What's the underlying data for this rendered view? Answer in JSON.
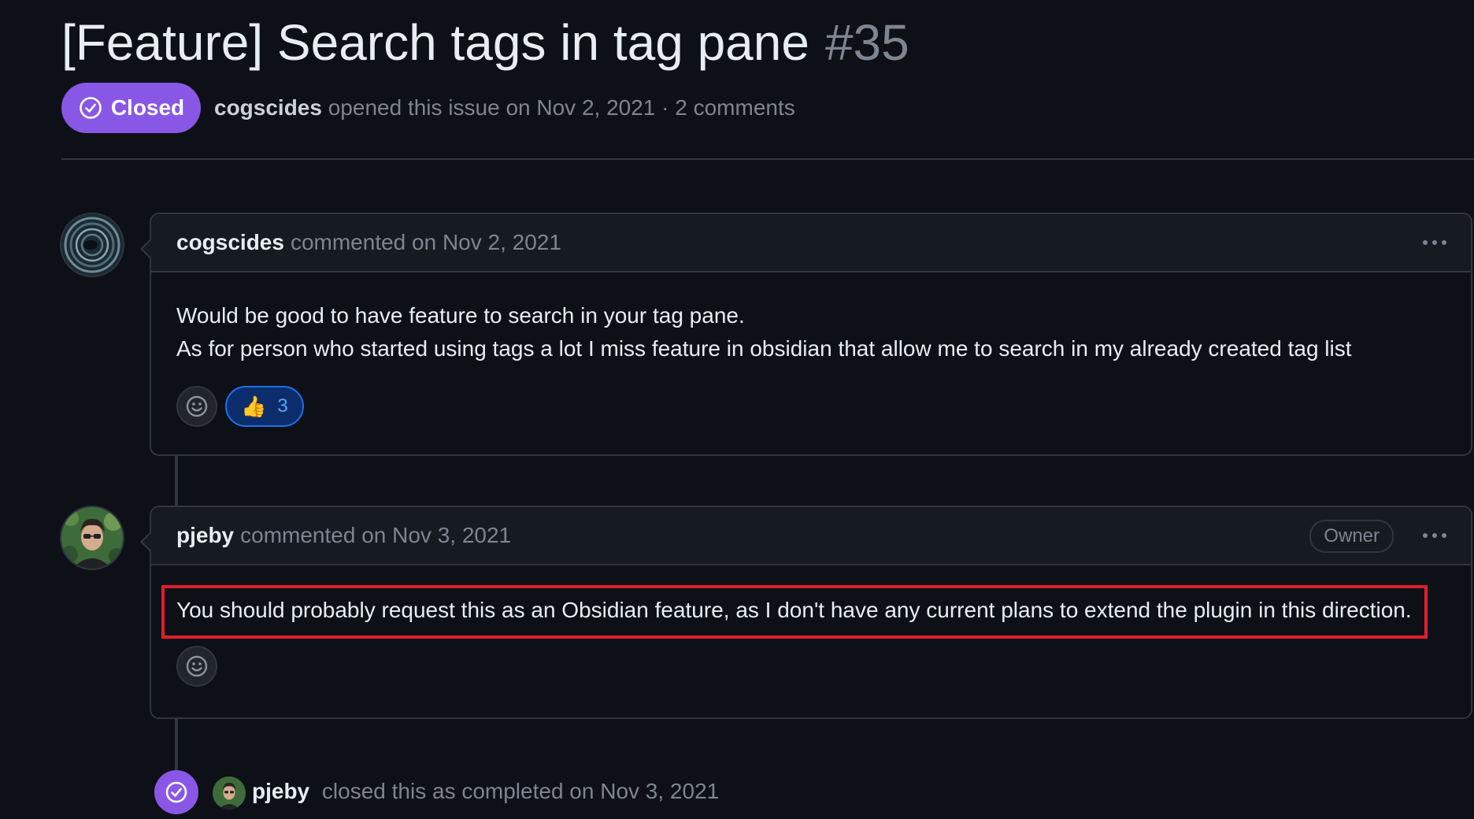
{
  "issue": {
    "title": "[Feature] Search tags in tag pane",
    "number": "#35",
    "state": "Closed",
    "state_color": "#8957e5",
    "author": "cogscides",
    "meta_text": "opened this issue on Nov 2, 2021 · 2 comments"
  },
  "comments": [
    {
      "author": "cogscides",
      "meta": "commented on Nov 2, 2021",
      "avatar_icon": "spiral-avatar",
      "body": [
        "Would be good to have feature to search in your tag pane.",
        "As for person who started using tags a lot I miss feature in obsidian that allow me to search in my already created tag list"
      ],
      "reactions": [
        {
          "emoji": "👍",
          "icon": "thumbs-up-icon",
          "count": "3"
        }
      ]
    },
    {
      "author": "pjeby",
      "meta": "commented on Nov 3, 2021",
      "badge": "Owner",
      "avatar_icon": "person-avatar",
      "body": [
        "You should probably request this as an Obsidian feature, as I don't have any current plans to extend the plugin in this direction."
      ],
      "reactions": []
    }
  ],
  "event": {
    "actor": "pjeby",
    "text": "closed this as completed on Nov 3, 2021",
    "icon": "check-circle-icon"
  },
  "colors": {
    "background": "#0d1117",
    "highlight": "#e01e2b",
    "closed_purple": "#8957e5"
  }
}
